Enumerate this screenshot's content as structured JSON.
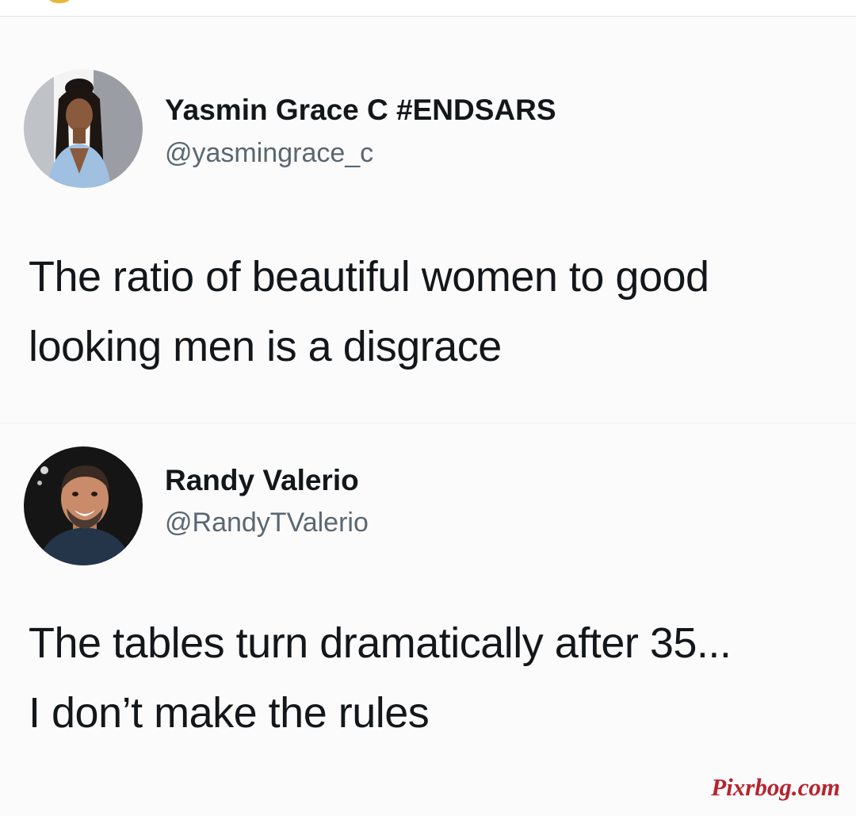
{
  "tweets": [
    {
      "author": {
        "name": "Yasmin Grace C #ENDSARS",
        "handle": "@yasmingrace_c",
        "avatar": "profile-photo-woman"
      },
      "text_lines": [
        "The ratio of beautiful women to good",
        "looking men is a disgrace"
      ]
    },
    {
      "author": {
        "name": "Randy Valerio",
        "handle": "@RandyTValerio",
        "avatar": "profile-photo-man"
      },
      "text_lines": [
        "The tables turn dramatically after 35...",
        "I don’t make the rules"
      ]
    }
  ],
  "watermark": "Pixrbog.com",
  "colors": {
    "text": "#14171a",
    "handle": "#5b6770",
    "watermark": "#b8232f",
    "background": "#fbfbfb"
  }
}
